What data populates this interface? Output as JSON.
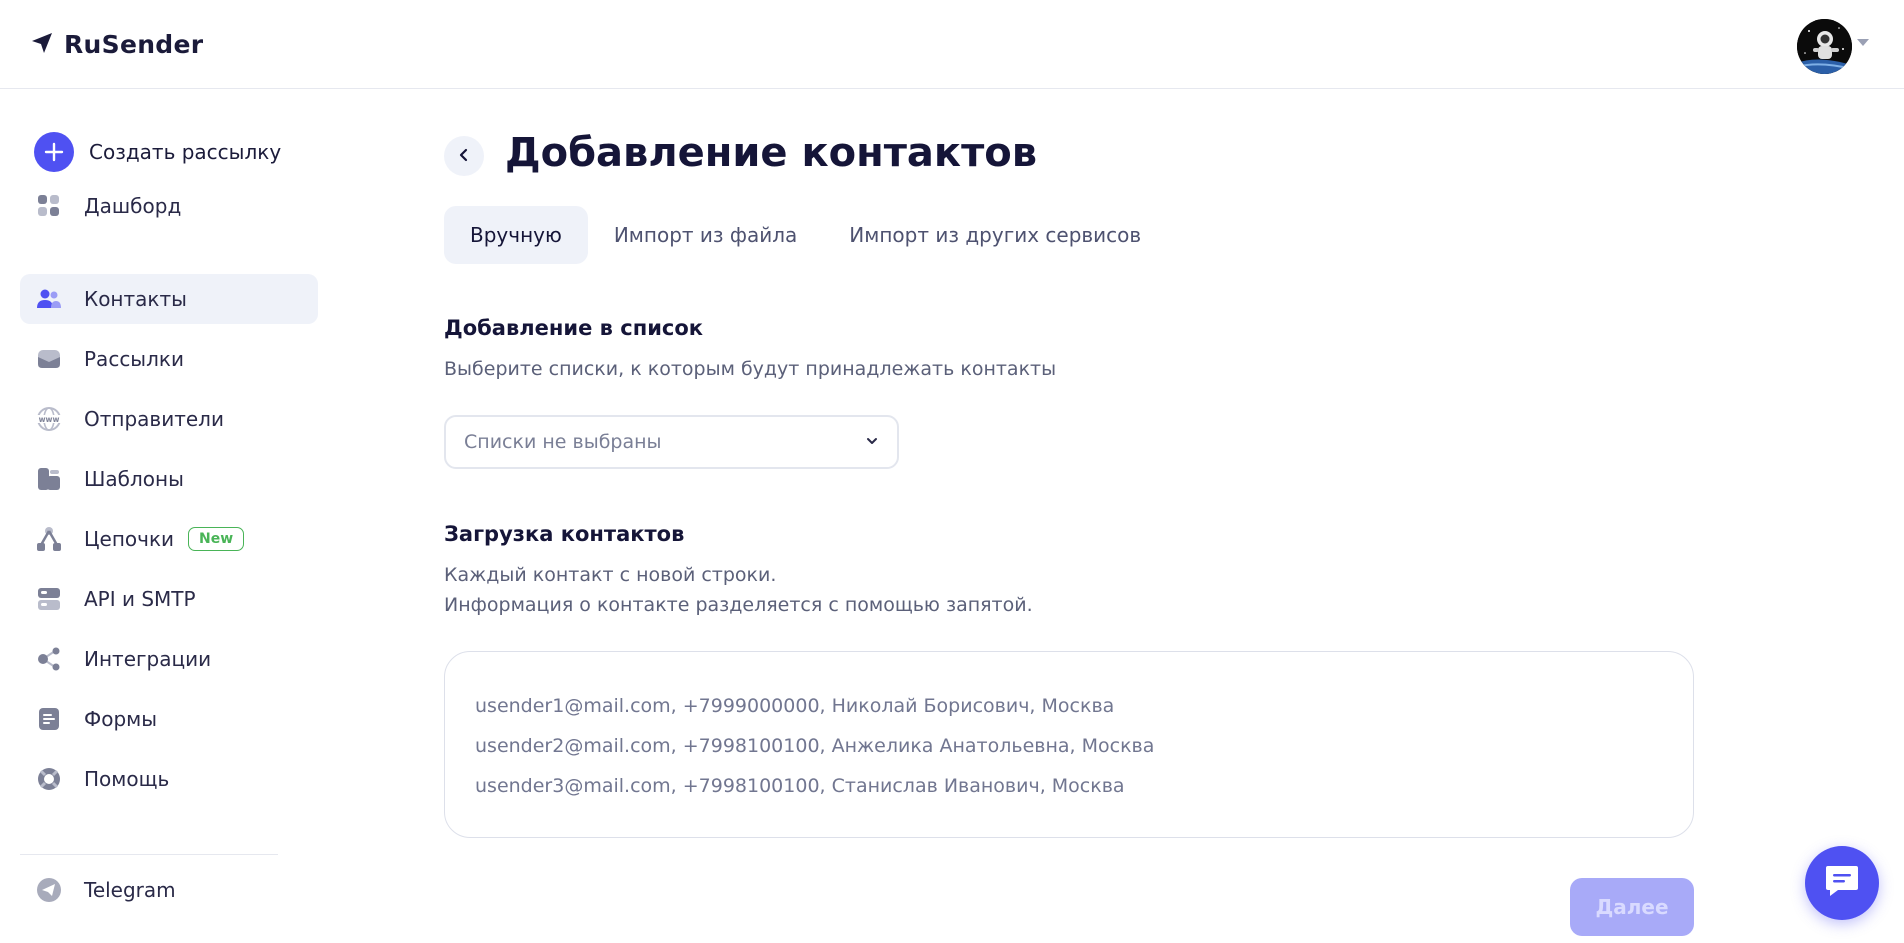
{
  "app": {
    "name": "RuSender"
  },
  "colors": {
    "accent": "#4f51f2",
    "active_bg": "#eff2f9",
    "badge_green": "#49b457",
    "icon_gray": "#7c8096"
  },
  "header": {
    "avatar_icon": "avatar-astronaut-icon"
  },
  "sidebar": {
    "create_label": "Создать рассылку",
    "items": [
      {
        "label": "Дашборд",
        "icon": "dashboard-icon"
      },
      {
        "label": "Контакты",
        "icon": "contacts-icon",
        "active": true
      },
      {
        "label": "Рассылки",
        "icon": "mail-icon"
      },
      {
        "label": "Отправители",
        "icon": "www-icon"
      },
      {
        "label": "Шаблоны",
        "icon": "templates-icon"
      },
      {
        "label": "Цепочки",
        "icon": "chains-icon",
        "badge": "New"
      },
      {
        "label": "API и SMTP",
        "icon": "server-icon"
      },
      {
        "label": "Интеграции",
        "icon": "integrations-icon"
      },
      {
        "label": "Формы",
        "icon": "forms-icon"
      },
      {
        "label": "Помощь",
        "icon": "help-icon"
      }
    ],
    "telegram_label": "Telegram"
  },
  "main": {
    "title": "Добавление контактов",
    "tabs": [
      "Вручную",
      "Импорт из файла",
      "Импорт из других сервисов"
    ],
    "active_tab": 0,
    "list_section": {
      "title": "Добавление в список",
      "description": "Выберите списки, к которым будут принадлежать контакты",
      "select_placeholder": "Списки не выбраны"
    },
    "upload_section": {
      "title": "Загрузка контактов",
      "description_line1": "Каждый контакт с новой строки.",
      "description_line2": "Информация о контакте разделяется с помощью запятой.",
      "placeholder_lines": [
        "usender1@mail.com,  +7999000000,  Николай Борисович,  Москва",
        "usender2@mail.com,  +7998100100,  Анжелика Анатольевна,  Москва",
        "usender3@mail.com,  +7998100100,  Станислав Иванович,  Москва"
      ]
    },
    "next_label": "Далее"
  }
}
